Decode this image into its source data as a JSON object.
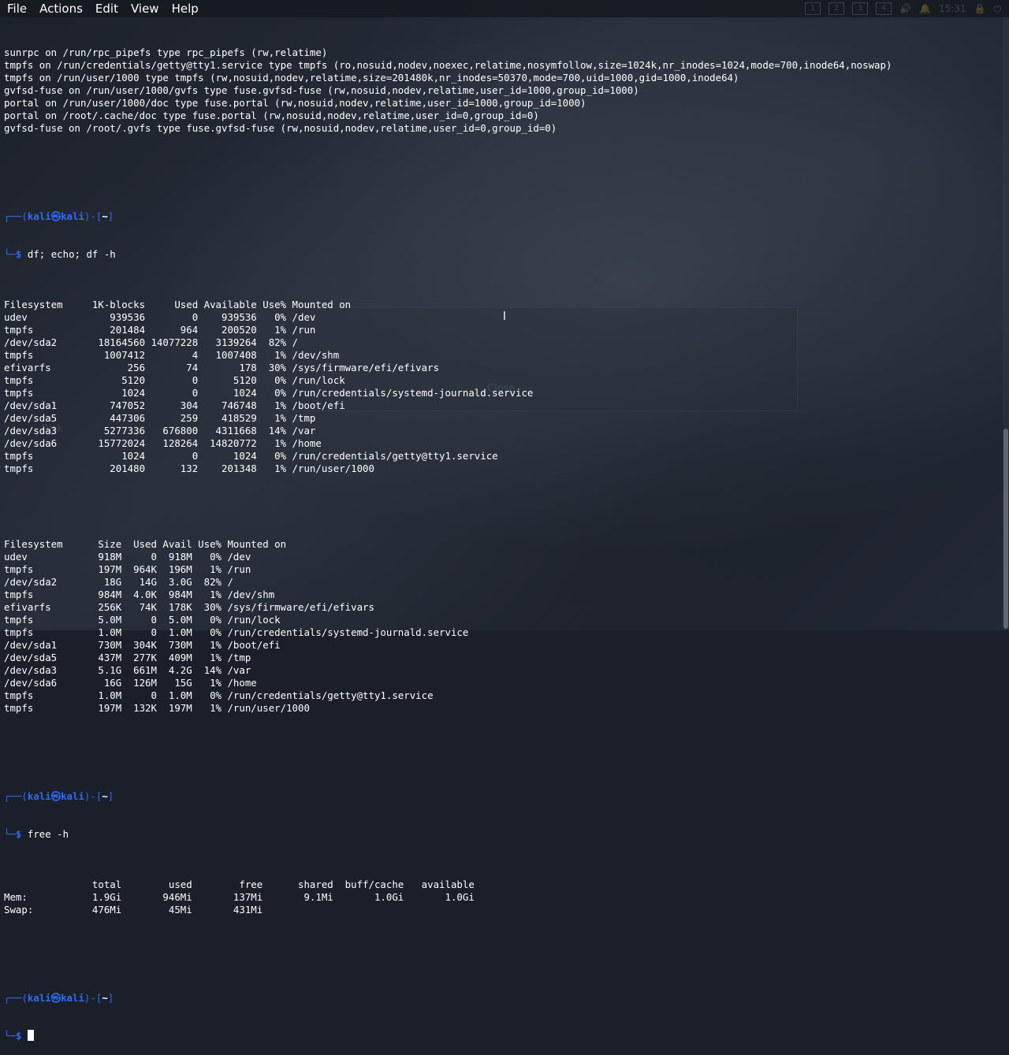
{
  "menu": {
    "items": [
      "File",
      "Actions",
      "Edit",
      "View",
      "Help"
    ]
  },
  "tray": {
    "workspaces": [
      "1",
      "2",
      "3",
      "4"
    ],
    "clock": "15:31"
  },
  "prompt": {
    "user": "kali",
    "host": "kali",
    "path": "~"
  },
  "mount_lines": [
    "sunrpc on /run/rpc_pipefs type rpc_pipefs (rw,relatime)",
    "tmpfs on /run/credentials/getty@tty1.service type tmpfs (ro,nosuid,nodev,noexec,relatime,nosymfollow,size=1024k,nr_inodes=1024,mode=700,inode64,noswap)",
    "tmpfs on /run/user/1000 type tmpfs (rw,nosuid,nodev,relatime,size=201480k,nr_inodes=50370,mode=700,uid=1000,gid=1000,inode64)",
    "gvfsd-fuse on /run/user/1000/gvfs type fuse.gvfsd-fuse (rw,nosuid,nodev,relatime,user_id=1000,group_id=1000)",
    "portal on /run/user/1000/doc type fuse.portal (rw,nosuid,nodev,relatime,user_id=1000,group_id=1000)",
    "portal on /root/.cache/doc type fuse.portal (rw,nosuid,nodev,relatime,user_id=0,group_id=0)",
    "gvfsd-fuse on /root/.gvfs type fuse.gvfsd-fuse (rw,nosuid,nodev,relatime,user_id=0,group_id=0)"
  ],
  "cmd1": "df; echo; df -h",
  "df_lines": [
    "Filesystem     1K-blocks     Used Available Use% Mounted on",
    "udev              939536        0    939536   0% /dev",
    "tmpfs             201484      964    200520   1% /run",
    "/dev/sda2       18164560 14077228   3139264  82% /",
    "tmpfs            1007412        4   1007408   1% /dev/shm",
    "efivarfs             256       74       178  30% /sys/firmware/efi/efivars",
    "tmpfs               5120        0      5120   0% /run/lock",
    "tmpfs               1024        0      1024   0% /run/credentials/systemd-journald.service",
    "/dev/sda1         747052      304    746748   1% /boot/efi",
    "/dev/sda5         447306      259    418529   1% /tmp",
    "/dev/sda3        5277336   676800   4311668  14% /var",
    "/dev/sda6       15772024   128264  14820772   1% /home",
    "tmpfs               1024        0      1024   0% /run/credentials/getty@tty1.service",
    "tmpfs             201480      132    201348   1% /run/user/1000"
  ],
  "dfh_lines": [
    "Filesystem      Size  Used Avail Use% Mounted on",
    "udev            918M     0  918M   0% /dev",
    "tmpfs           197M  964K  196M   1% /run",
    "/dev/sda2        18G   14G  3.0G  82% /",
    "tmpfs           984M  4.0K  984M   1% /dev/shm",
    "efivarfs        256K   74K  178K  30% /sys/firmware/efi/efivars",
    "tmpfs           5.0M     0  5.0M   0% /run/lock",
    "tmpfs           1.0M     0  1.0M   0% /run/credentials/systemd-journald.service",
    "/dev/sda1       730M  304K  730M   1% /boot/efi",
    "/dev/sda5       437M  277K  409M   1% /tmp",
    "/dev/sda3       5.1G  661M  4.2G  14% /var",
    "/dev/sda6        16G  126M   15G   1% /home",
    "tmpfs           1.0M     0  1.0M   0% /run/credentials/getty@tty1.service",
    "tmpfs           197M  132K  197M   1% /run/user/1000"
  ],
  "cmd2": "free -h",
  "free_lines": [
    "               total        used        free      shared  buff/cache   available",
    "Mem:           1.9Gi       946Mi       137Mi       9.1Mi       1.0Gi       1.0Gi",
    "Swap:          476Mi        45Mi       431Mi"
  ],
  "background_ghost": {
    "label_a": "Disk",
    "label_b": "Close"
  },
  "colors": {
    "prompt_blue": "#2f6cf0",
    "text": "#ffffff",
    "background": "#1a1f29"
  }
}
